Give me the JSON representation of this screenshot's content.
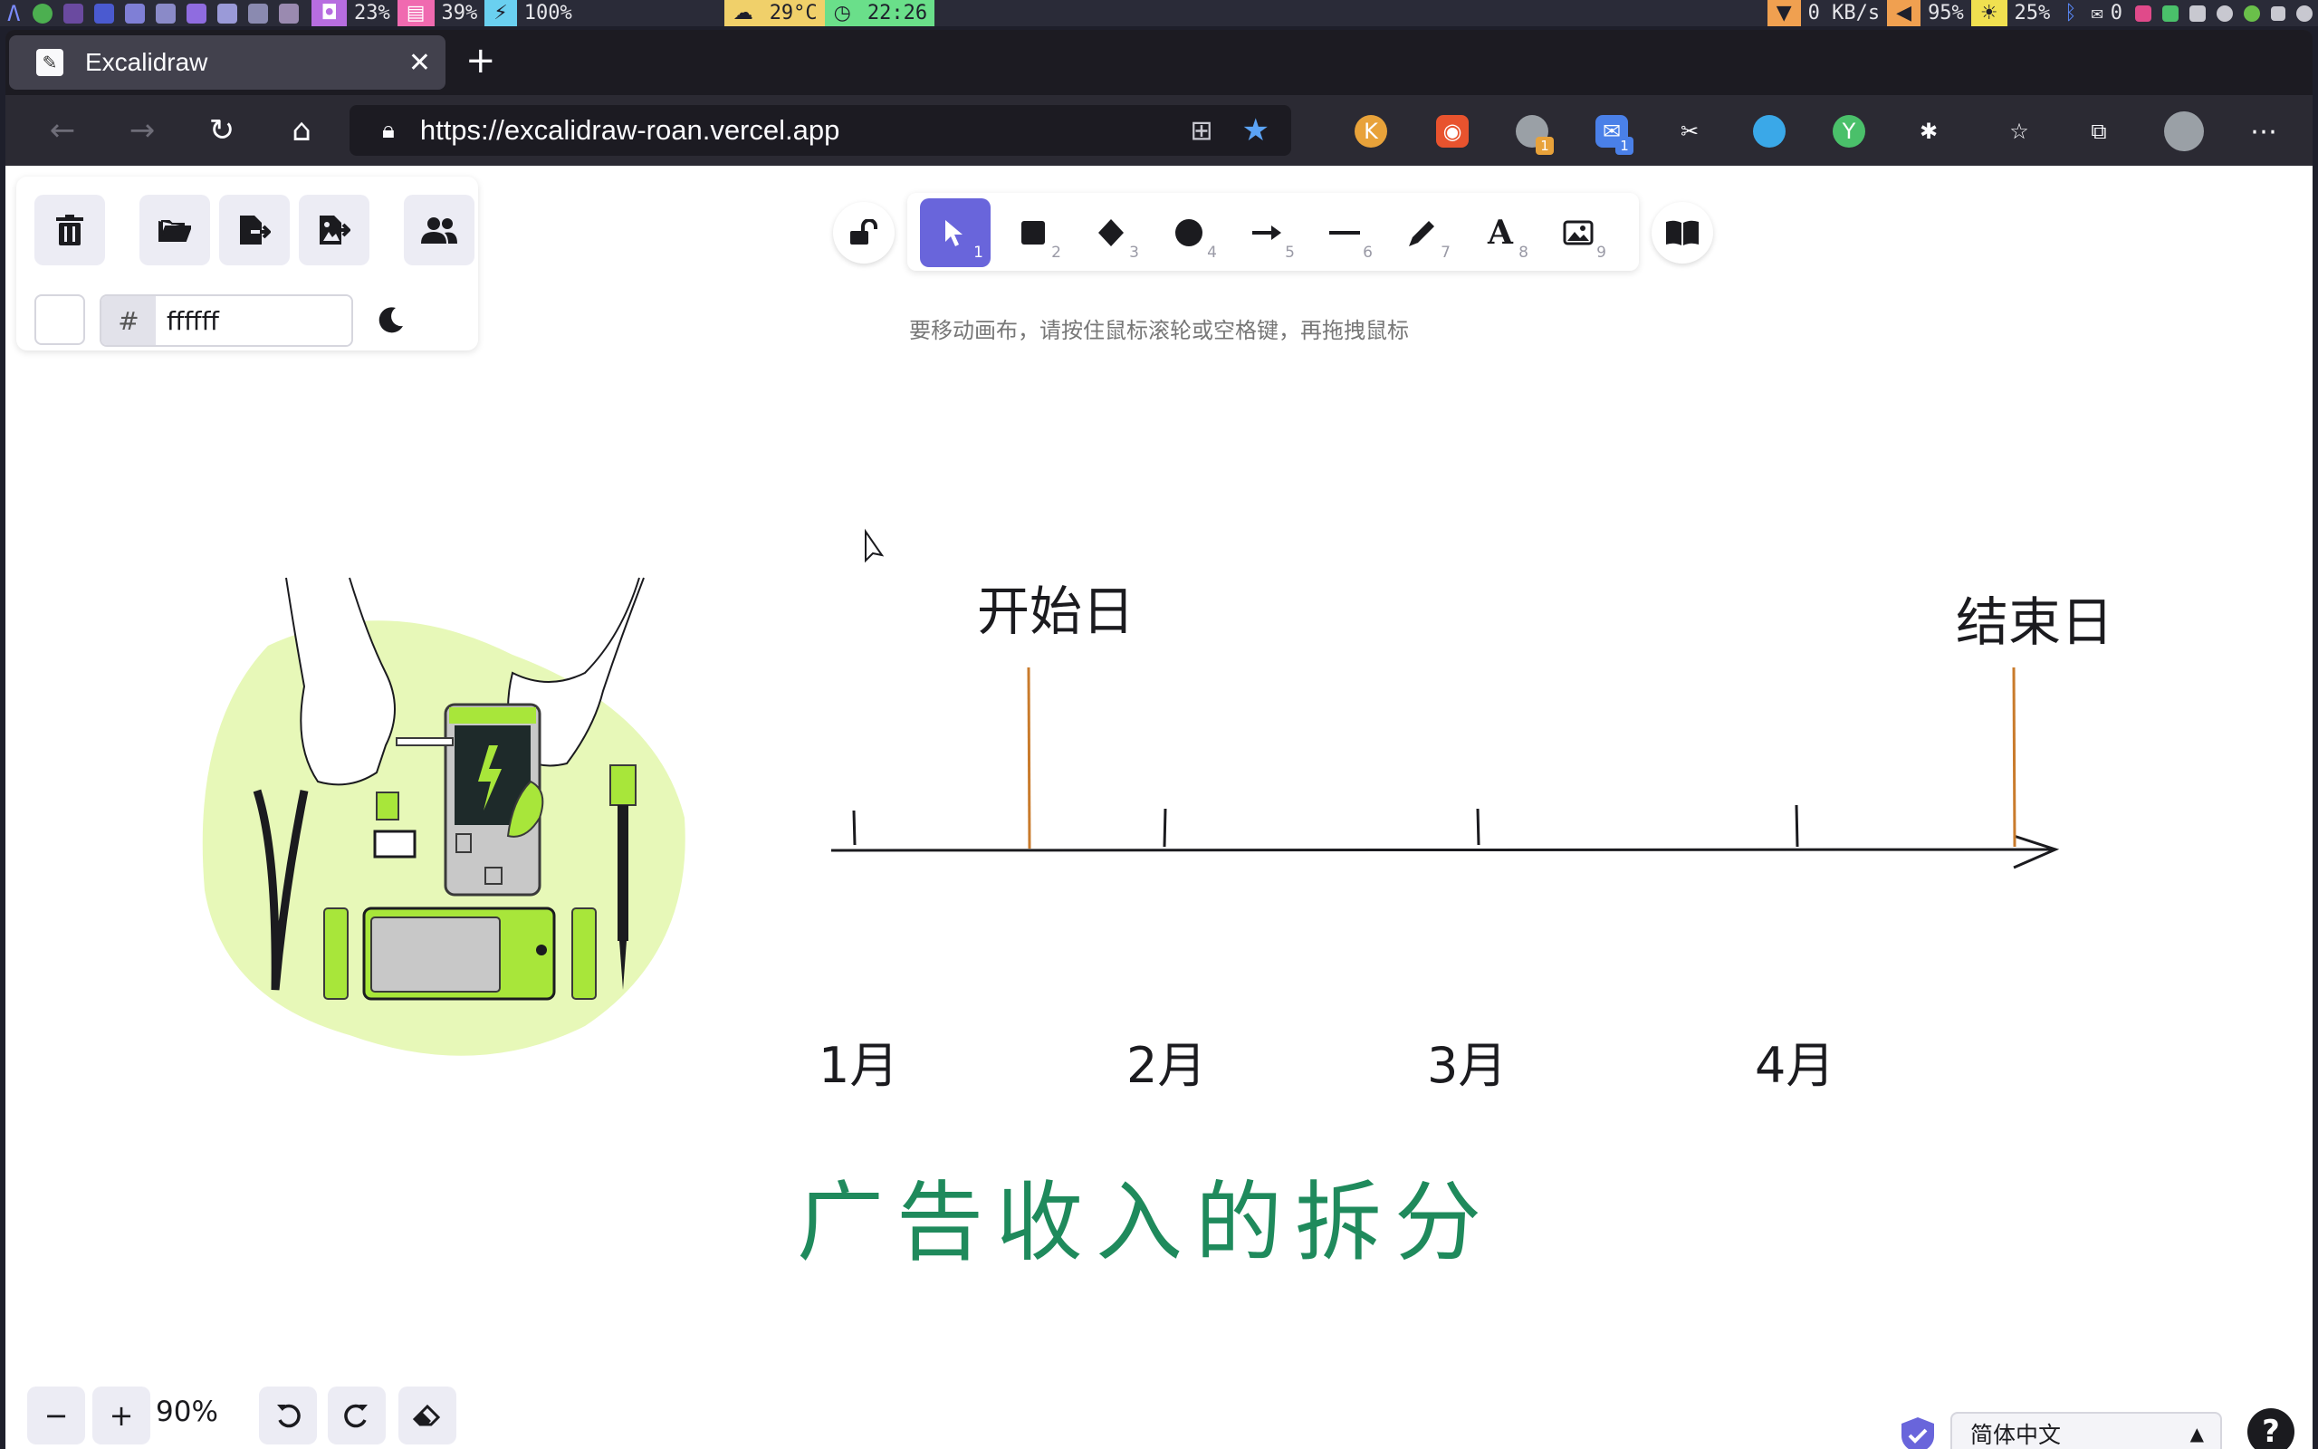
{
  "system_bar": {
    "cpu": "23%",
    "memory": "39%",
    "battery_charge": "100%",
    "temperature": "29°C",
    "clock": "22:26",
    "network": "0 KB/s",
    "volume": "95%",
    "brightness": "25%",
    "mail_count": "0"
  },
  "browser": {
    "tab_title": "Excalidraw",
    "url": "https://excalidraw-roan.vercel.app",
    "extension_badges": [
      "1",
      "1"
    ]
  },
  "panel": {
    "bg_hex_value": "ffffff",
    "hash": "#"
  },
  "toolbar": {
    "hint": "要移动画布，请按住鼠标滚轮或空格键，再拖拽鼠标",
    "tools": [
      {
        "name": "selection",
        "key": "1"
      },
      {
        "name": "rectangle",
        "key": "2"
      },
      {
        "name": "diamond",
        "key": "3"
      },
      {
        "name": "ellipse",
        "key": "4"
      },
      {
        "name": "arrow",
        "key": "5"
      },
      {
        "name": "line",
        "key": "6"
      },
      {
        "name": "draw",
        "key": "7"
      },
      {
        "name": "text",
        "key": "8"
      },
      {
        "name": "image",
        "key": "9"
      }
    ],
    "text_tool_glyph": "A"
  },
  "drawing": {
    "start_label": "开始日",
    "end_label": "结束日",
    "months": [
      "1月",
      "2月",
      "3月",
      "4月"
    ],
    "title": "广告收入的拆分",
    "title_color": "#1f8a5c",
    "marker_color": "#c97b2c"
  },
  "footer": {
    "zoom": "90%",
    "language": "简体中文",
    "help": "?"
  }
}
